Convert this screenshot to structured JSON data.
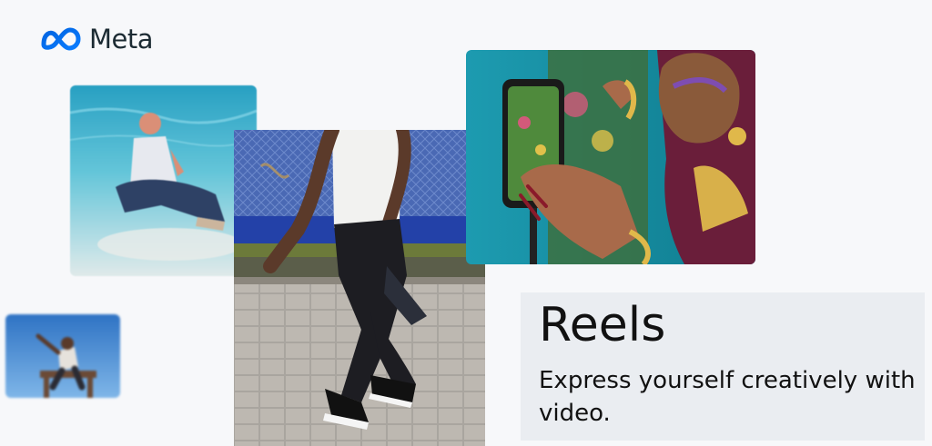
{
  "brand": {
    "name": "Meta",
    "logo_icon": "meta-infinity-icon",
    "color": "#0866ff"
  },
  "feature": {
    "title": "Reels",
    "description": "Express yourself creatively with video."
  },
  "images": [
    {
      "name": "underwater-person-photo"
    },
    {
      "name": "jumping-person-photo"
    },
    {
      "name": "dancer-photo"
    },
    {
      "name": "phone-recording-photo"
    }
  ],
  "colors": {
    "background": "#f7f8fa",
    "text_card": "#eaedf1",
    "text": "#111111"
  }
}
